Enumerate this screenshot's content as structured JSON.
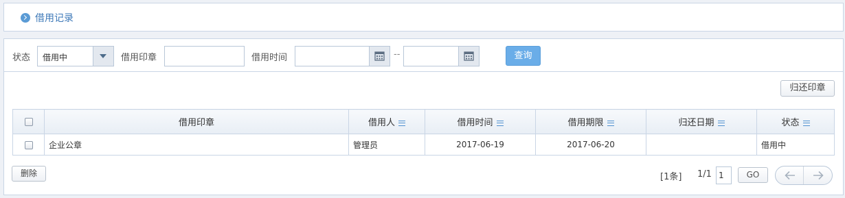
{
  "header": {
    "icon": "chevron-circle-right-icon",
    "title": "借用记录"
  },
  "filters": {
    "status_label": "状态",
    "status_value": "借用中",
    "seal_label": "借用印章",
    "seal_value": "",
    "time_label": "借用时间",
    "start_date": "",
    "end_date": "",
    "separator": "--",
    "query_button": "查询",
    "calendar_icon": "calendar-icon"
  },
  "toolbar": {
    "return_button": "归还印章"
  },
  "table": {
    "columns": [
      "借用印章",
      "借用人",
      "借用时间",
      "借用期限",
      "归还日期",
      "状态"
    ],
    "rows": [
      {
        "seal": "企业公章",
        "borrower": "管理员",
        "borrow_time": "2017-06-19",
        "deadline": "2017-06-20",
        "return_date": "",
        "status": "借用中"
      }
    ]
  },
  "footer": {
    "delete_button": "删除",
    "count": "[1条]",
    "page_fraction": "1/1",
    "page_input": "1",
    "go_button": "GO"
  },
  "colors": {
    "accent": "#6aade8",
    "title": "#3e79b8",
    "border": "#c9d5e5"
  }
}
